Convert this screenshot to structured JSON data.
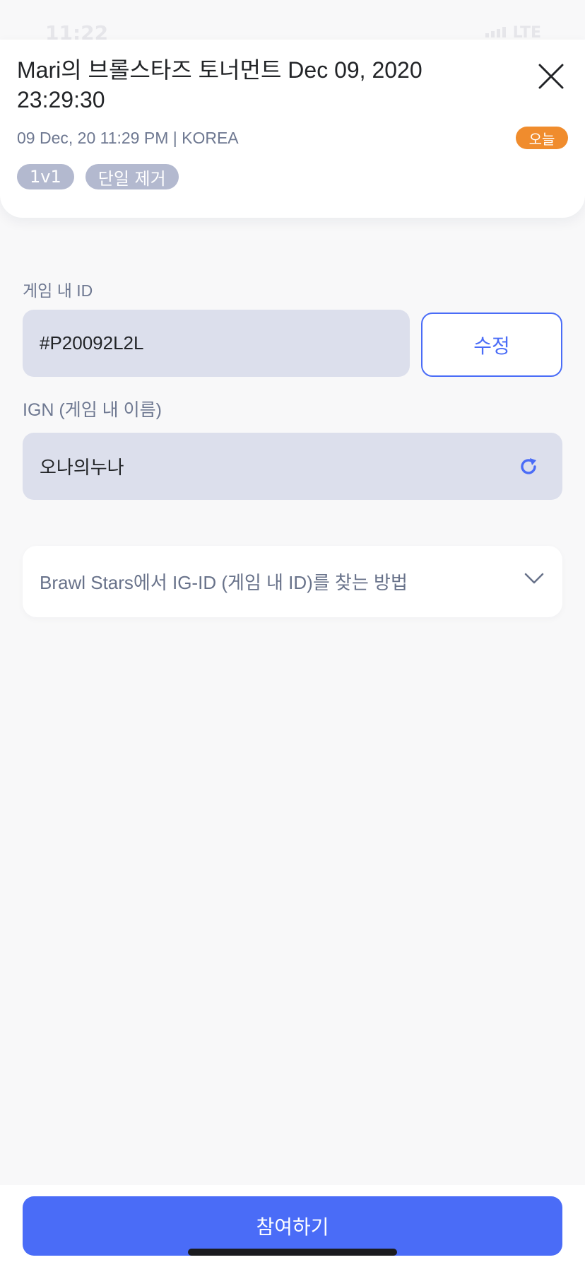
{
  "status_bar": {
    "time": "11:22",
    "network": "LTE"
  },
  "header": {
    "title": "Mari의 브롤스타즈 토너먼트 Dec 09, 2020 23:29:30",
    "meta": "09 Dec, 20 11:29 PM | KOREA",
    "today_badge": "오늘",
    "tags": [
      "1v1",
      "단일 제거"
    ],
    "close_icon": "close-icon"
  },
  "form": {
    "ingame_id_label": "게임 내 ID",
    "ingame_id_value": "#P20092L2L",
    "edit_label": "수정",
    "ign_label": "IGN (게임 내 이름)",
    "ign_value": "오나의누나",
    "refresh_icon": "refresh-icon"
  },
  "help": {
    "accordion_label": "Brawl Stars에서 IG-ID (게임 내 ID)를 찾는 방법",
    "chevron_icon": "chevron-down-icon"
  },
  "footer": {
    "join_label": "참여하기"
  },
  "colors": {
    "accent": "#4a6cf7",
    "badge_orange": "#f08c2d",
    "tag_gray": "#b3b9cf",
    "input_bg": "#dcdfec",
    "page_bg": "#f8f8f9"
  }
}
